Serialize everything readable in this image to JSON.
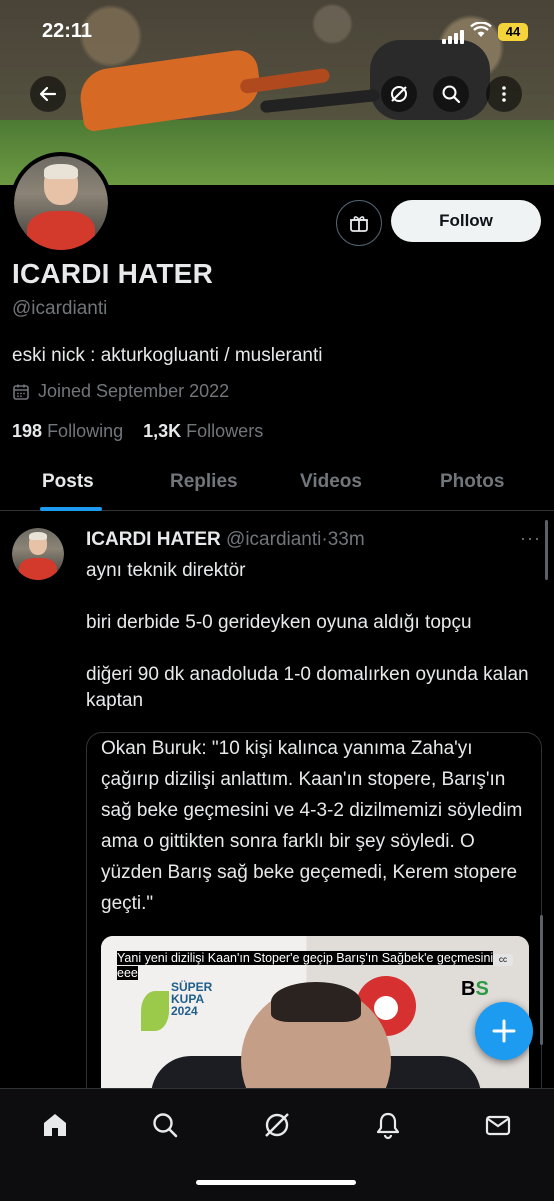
{
  "status_bar": {
    "time": "22:11",
    "battery": "44"
  },
  "profile": {
    "name": "ICARDI HATER",
    "handle": "@icardianti",
    "bio": "eski nick : akturkogluanti / musleranti",
    "joined": "Joined September 2022",
    "following_count": "198",
    "following_label": "Following",
    "followers_count": "1,3K",
    "followers_label": "Followers",
    "follow_button": "Follow"
  },
  "tabs": [
    {
      "label": "Posts",
      "active": true
    },
    {
      "label": "Replies",
      "active": false
    },
    {
      "label": "Videos",
      "active": false
    },
    {
      "label": "Photos",
      "active": false
    }
  ],
  "post": {
    "author_name": "ICARDI HATER",
    "author_handle": "@icardianti",
    "separator": "·",
    "time_ago": "33m",
    "more": "···",
    "lines": [
      "aynı teknik direktör",
      "biri derbide 5-0 gerideyken oyuna aldığı topçu",
      "diğeri 90 dk anadoluda 1-0 domalırken oyunda kalan kaptan"
    ],
    "quote": {
      "text": "Okan Buruk: \"10 kişi kalınca yanıma Zaha'yı çağırıp dizilişi anlattım. Kaan'ın stopere, Barış'ın sağ beke geçmesini ve 4-3-2 dizilmemizi söyledim ama o gittikten sonra farklı bir şey söyledi. O yüzden Barış sağ beke geçemedi, Kerem stopere geçti.\"",
      "video_caption": "Yani yeni dizilişi Kaan'ın Stoper'e geçip Barış'ın Sağbek'e geçmesini eee",
      "cc_label": "cc",
      "logo_text_1": "SÜPER",
      "logo_text_2": "KUPA",
      "logo_text_3": "2024",
      "bs_b": "B",
      "bs_s": "S"
    }
  },
  "bottom_nav": [
    {
      "icon": "home-icon"
    },
    {
      "icon": "search-icon"
    },
    {
      "icon": "grok-icon"
    },
    {
      "icon": "bell-icon"
    },
    {
      "icon": "mail-icon"
    }
  ],
  "colors": {
    "accent": "#1d9bf0",
    "background": "#000000",
    "muted": "#71767b"
  }
}
